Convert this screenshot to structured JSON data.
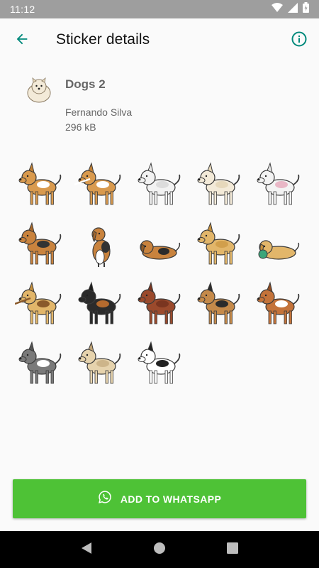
{
  "status_bar": {
    "time": "11:12",
    "icons": [
      "wifi-icon",
      "signal-icon",
      "battery-icon"
    ]
  },
  "app_bar": {
    "back_icon": "arrow-back-icon",
    "title": "Sticker details",
    "info_icon": "info-icon"
  },
  "pack": {
    "name": "Dogs 2",
    "author": "Fernando Silva",
    "size": "296 kB",
    "tray_icon": "white-fluffy-dog"
  },
  "stickers": [
    {
      "name": "corgi-standing",
      "icon": "dog-icon",
      "body": "#d99a4e",
      "accent": "#ffffff",
      "ear": "#c07f35"
    },
    {
      "name": "corgi-with-stick",
      "icon": "dog-icon",
      "body": "#d99a4e",
      "accent": "#ffffff",
      "ear": "#c07f35"
    },
    {
      "name": "white-poodle",
      "icon": "dog-icon",
      "body": "#f2f2f2",
      "accent": "#dcdcdc",
      "ear": "#e6e6e6"
    },
    {
      "name": "white-samoyed",
      "icon": "dog-icon",
      "body": "#f3ead8",
      "accent": "#e6d8bb",
      "ear": "#e6d8bb"
    },
    {
      "name": "white-bulldog",
      "icon": "dog-icon",
      "body": "#f3f3f3",
      "accent": "#e9b7c6",
      "ear": "#e2e2e2"
    },
    {
      "name": "beagle-standing",
      "icon": "dog-icon",
      "body": "#c9833e",
      "accent": "#333333",
      "ear": "#a8692c"
    },
    {
      "name": "beagle-sitting",
      "icon": "dog-icon",
      "body": "#c9833e",
      "accent": "#333333",
      "ear": "#a8692c"
    },
    {
      "name": "spaniel-lying",
      "icon": "dog-icon",
      "body": "#c9833e",
      "accent": "#2b2b2b",
      "ear": "#8f5a26"
    },
    {
      "name": "labrador-yellow",
      "icon": "dog-icon",
      "body": "#e2b66a",
      "accent": "#d19f4c",
      "ear": "#c48f3e"
    },
    {
      "name": "labrador-with-ball",
      "icon": "dog-icon",
      "body": "#e2b66a",
      "accent": "#3aa57a",
      "ear": "#c48f3e"
    },
    {
      "name": "labrador-fetch-stick",
      "icon": "dog-icon",
      "body": "#e2b66a",
      "accent": "#8a5a2b",
      "ear": "#c48f3e"
    },
    {
      "name": "rottweiler",
      "icon": "dog-icon",
      "body": "#2b2b2b",
      "accent": "#b46a2e",
      "ear": "#1c1c1c"
    },
    {
      "name": "doberman",
      "icon": "dog-icon",
      "body": "#9b4a2c",
      "accent": "#7a3520",
      "ear": "#7a3520"
    },
    {
      "name": "german-shepherd",
      "icon": "dog-icon",
      "body": "#c58a4a",
      "accent": "#2b2b2b",
      "ear": "#2b2b2b"
    },
    {
      "name": "boxer",
      "icon": "dog-icon",
      "body": "#c4733a",
      "accent": "#ffffff",
      "ear": "#8f4c22"
    },
    {
      "name": "husky",
      "icon": "dog-icon",
      "body": "#7a7a7a",
      "accent": "#ffffff",
      "ear": "#555555"
    },
    {
      "name": "afghan-hound",
      "icon": "dog-icon",
      "body": "#e6d3ad",
      "accent": "#cdb58a",
      "ear": "#bfa274"
    },
    {
      "name": "great-dane-harlequin",
      "icon": "dog-icon",
      "body": "#ffffff",
      "accent": "#222222",
      "ear": "#222222"
    }
  ],
  "add_button": {
    "icon": "whatsapp-icon",
    "label": "ADD TO WHATSAPP",
    "color": "#4ec236"
  },
  "nav_bar": {
    "back": "nav-back-icon",
    "home": "nav-home-icon",
    "recents": "nav-recents-icon"
  },
  "colors": {
    "accent": "#00897b",
    "status_bar": "#9e9e9e",
    "background": "#fafafa"
  }
}
